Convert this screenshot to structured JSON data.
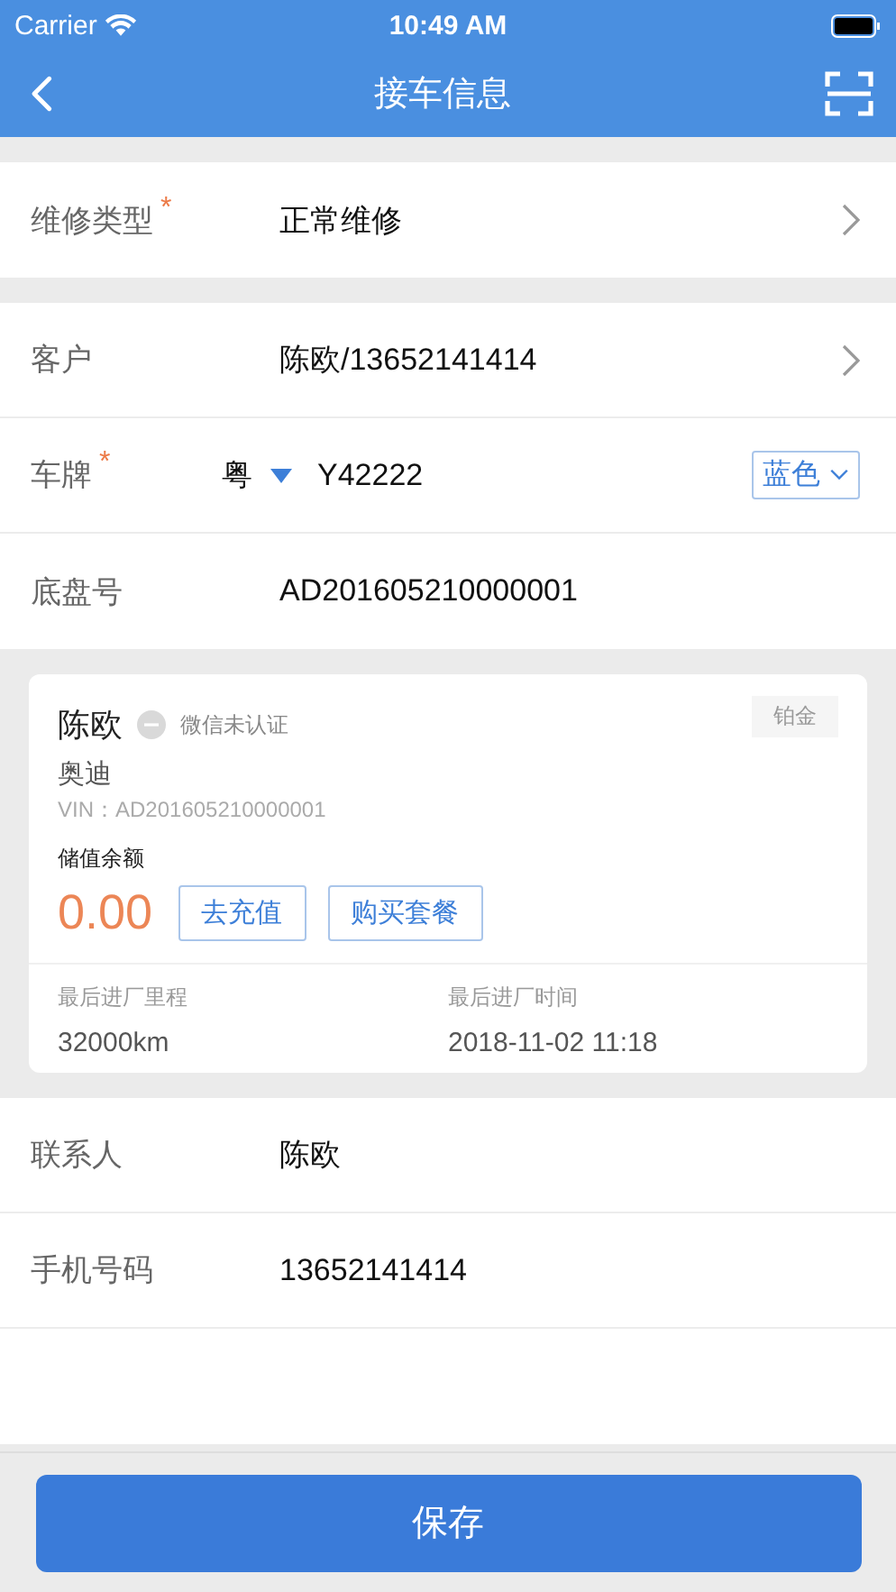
{
  "status_bar": {
    "carrier": "Carrier",
    "time": "10:49 AM"
  },
  "nav": {
    "title": "接车信息"
  },
  "sections": [
    {
      "rows": [
        {
          "kind": "link",
          "label": "维修类型",
          "required_mark": "*",
          "value": "正常维修"
        }
      ]
    },
    {
      "rows": [
        {
          "kind": "link",
          "label": "客户",
          "value": "陈欧/13652141414"
        },
        {
          "kind": "plate",
          "label": "车牌",
          "required_mark": "*",
          "province": "粤",
          "value": "Y42222",
          "plate_color": "蓝色"
        },
        {
          "kind": "text",
          "label": "底盘号",
          "value": "AD201605210000001"
        }
      ]
    }
  ],
  "customer_card": {
    "name": "陈欧",
    "wechat_status": "微信未认证",
    "level_tag": "铂金",
    "brand": "奥迪",
    "vin": "VIN：AD201605210000001",
    "balance_label": "储值余额",
    "balance": "0.00",
    "buttons": [
      "去充值",
      "购买套餐"
    ],
    "stats": [
      {
        "label": "最后进厂里程",
        "value": "32000km"
      },
      {
        "label": "最后进厂时间",
        "value": "2018-11-02 11:18"
      }
    ]
  },
  "contact_rows": [
    {
      "kind": "text",
      "label": "联系人",
      "value": "陈欧"
    },
    {
      "kind": "text",
      "label": "手机号码",
      "value": "13652141414"
    }
  ],
  "save_button": "保存"
}
